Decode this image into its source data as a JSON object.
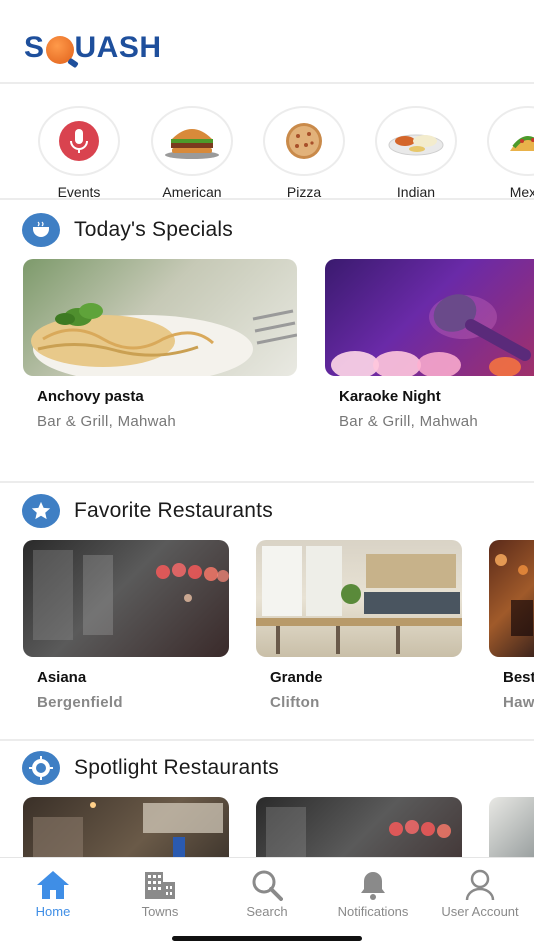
{
  "app": {
    "logo_text_pre": "S",
    "logo_text_post": "UASH"
  },
  "categories": [
    {
      "label": "Events",
      "icon": "microphone-icon"
    },
    {
      "label": "American",
      "icon": "burger-icon"
    },
    {
      "label": "Pizza",
      "icon": "pizza-icon"
    },
    {
      "label": "Indian",
      "icon": "curry-icon"
    },
    {
      "label": "Mexic",
      "icon": "taco-icon"
    }
  ],
  "specials": {
    "title": "Today's Specials",
    "items": [
      {
        "name": "Anchovy pasta",
        "sub": "Bar & Grill, Mahwah"
      },
      {
        "name": "Karaoke Night",
        "sub": "Bar & Grill, Mahwah"
      }
    ]
  },
  "favorites": {
    "title": "Favorite Restaurants",
    "items": [
      {
        "name": "Asiana",
        "sub": "Bergenfield"
      },
      {
        "name": "Grande",
        "sub": "Clifton"
      },
      {
        "name": "Best",
        "sub": "Haw"
      }
    ]
  },
  "spotlight": {
    "title": "Spotlight Restaurants"
  },
  "tabs": [
    {
      "label": "Home",
      "active": true
    },
    {
      "label": "Towns",
      "active": false
    },
    {
      "label": "Search",
      "active": false
    },
    {
      "label": "Notifications",
      "active": false
    },
    {
      "label": "User Account",
      "active": false
    }
  ],
  "colors": {
    "brand": "#1e4f9c",
    "accent": "#3f8ee6",
    "section_icon": "#3f7fc4"
  }
}
